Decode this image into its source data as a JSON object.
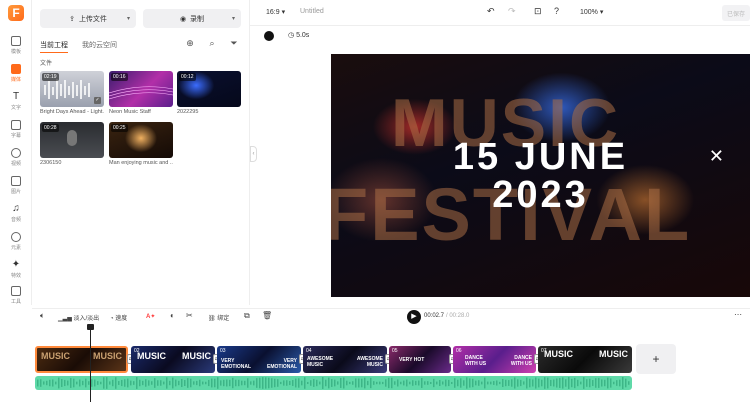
{
  "rail": {
    "logo": "F",
    "items": [
      {
        "label": "模板"
      },
      {
        "label": "媒体"
      },
      {
        "label": "文字"
      },
      {
        "label": "字幕"
      },
      {
        "label": "视频"
      },
      {
        "label": "图片"
      },
      {
        "label": "音频"
      },
      {
        "label": "元素"
      },
      {
        "label": "特效"
      },
      {
        "label": "工具"
      }
    ]
  },
  "panel": {
    "upload_label": "上传文件",
    "record_label": "录制",
    "tabs": [
      "当前工程",
      "我的云空间"
    ],
    "folder_label": "文件",
    "media": [
      {
        "duration": "02:19",
        "caption": "Bright Days Ahead - Light..."
      },
      {
        "duration": "00:16",
        "caption": "Neon Music Staff"
      },
      {
        "duration": "00:12",
        "caption": "2022295"
      },
      {
        "duration": "00:28",
        "caption": "2306150"
      },
      {
        "duration": "00:25",
        "caption": "Man enjoying music and ..."
      }
    ]
  },
  "topbar": {
    "aspect": "16:9",
    "title": "Untitled",
    "zoom": "100%",
    "export_label": "已保存"
  },
  "preview": {
    "duration": "5.0s"
  },
  "canvas": {
    "bg_word1": "MUSIC",
    "bg_word2": "FESTIVAL",
    "date_line1": "15 JUNE",
    "date_line2": "2023"
  },
  "timeline_toolbar": {
    "fade_label": "淡入/淡出",
    "speed_label": "速度",
    "detach_label": "绑定",
    "current_time": "00:02.7",
    "total_time": "/ 00:28.0"
  },
  "clips": [
    {
      "num": "",
      "t1": "MUSIC",
      "t2": "MUSIC"
    },
    {
      "num": "02",
      "t1": "MUSIC",
      "t2": "MUSIC"
    },
    {
      "num": "03",
      "t1": "VERY EMOTIONAL",
      "t2": "VERY EMOTIONAL"
    },
    {
      "num": "04",
      "t1": "AWESOME MUSIC",
      "t2": "AWESOME MUSIC"
    },
    {
      "num": "05",
      "t1": "VERY HOT",
      "t2": ""
    },
    {
      "num": "06",
      "t1": "DANCE WITH US",
      "t2": "DANCE WITH US"
    },
    {
      "num": "07",
      "t1": "MUSIC",
      "t2": "MUSIC"
    }
  ],
  "colors": {
    "accent": "#ff6a1a",
    "audio_track": "#5fd9a8"
  }
}
